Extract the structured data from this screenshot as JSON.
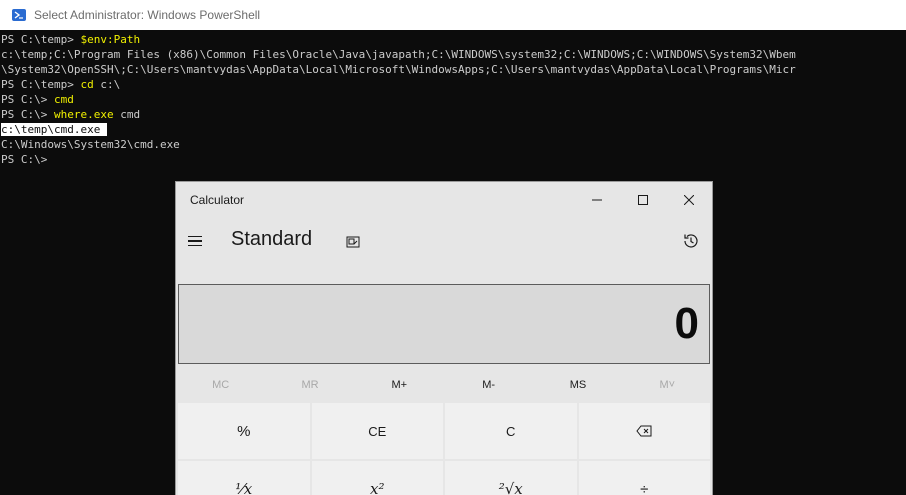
{
  "powershell": {
    "title": "Select Administrator: Windows PowerShell",
    "lines": [
      {
        "prompt": "PS C:\\temp> ",
        "cmd": "$env:Path",
        "rest": ""
      },
      {
        "text": "c:\\temp;C:\\Program Files (x86)\\Common Files\\Oracle\\Java\\javapath;C:\\WINDOWS\\system32;C:\\WINDOWS;C:\\WINDOWS\\System32\\Wbem"
      },
      {
        "text": "\\System32\\OpenSSH\\;C:\\Users\\mantvydas\\AppData\\Local\\Microsoft\\WindowsApps;C:\\Users\\mantvydas\\AppData\\Local\\Programs\\Micr"
      },
      {
        "prompt": "PS C:\\temp> ",
        "cmd": "cd",
        "rest": " c:\\"
      },
      {
        "prompt": "PS C:\\> ",
        "cmd": "cmd",
        "rest": ""
      },
      {
        "prompt": "PS C:\\> ",
        "cmd": "where.exe",
        "rest": " cmd"
      },
      {
        "selected": "c:\\temp\\cmd.exe "
      },
      {
        "text": "C:\\Windows\\System32\\cmd.exe"
      },
      {
        "text": "PS C:\\>"
      }
    ]
  },
  "calculator": {
    "title": "Calculator",
    "mode": "Standard",
    "display_value": "0",
    "memory_buttons": [
      {
        "label": "MC",
        "enabled": false
      },
      {
        "label": "MR",
        "enabled": false
      },
      {
        "label": "M+",
        "enabled": true
      },
      {
        "label": "M-",
        "enabled": true
      },
      {
        "label": "MS",
        "enabled": true
      },
      {
        "label": "M˅",
        "enabled": false
      }
    ],
    "keys": {
      "row1": [
        "%",
        "CE",
        "C",
        "backspace"
      ],
      "row2": [
        "⅟x",
        "x²",
        "²√x",
        "÷"
      ]
    }
  }
}
